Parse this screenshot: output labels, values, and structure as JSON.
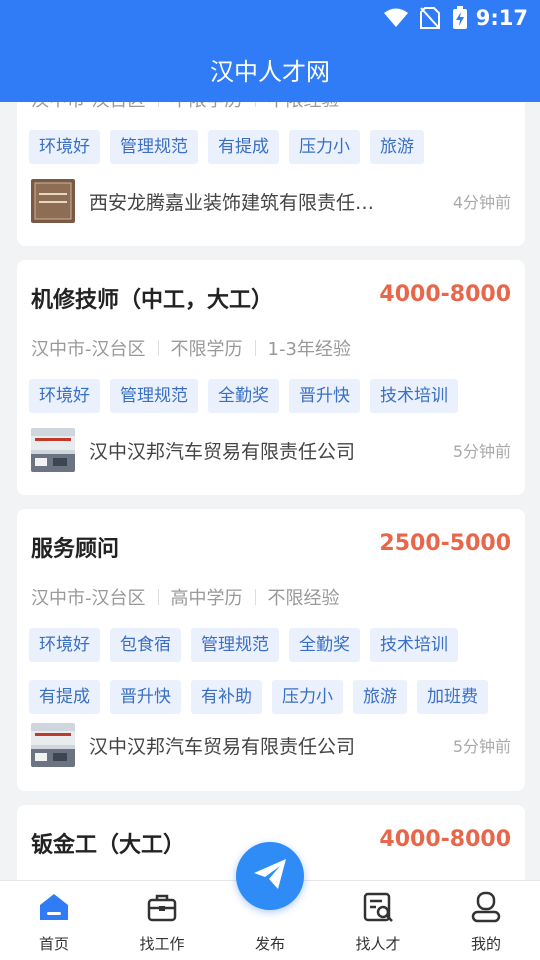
{
  "status": {
    "time": "9:17"
  },
  "app_title": "汉中人才网",
  "cards": [
    {
      "meta": [
        "汉中市-汉台区",
        "不限学历",
        "不限经验"
      ],
      "tags_rows": [
        [
          "环境好",
          "管理规范",
          "有提成",
          "压力小",
          "旅游"
        ]
      ],
      "company": "西安龙腾嘉业装饰建筑有限责任公司",
      "time_ago": "4分钟前"
    },
    {
      "title": "机修技师（中工，大工）",
      "salary": "4000-8000",
      "meta": [
        "汉中市-汉台区",
        "不限学历",
        "1-3年经验"
      ],
      "tags_rows": [
        [
          "环境好",
          "管理规范",
          "全勤奖",
          "晋升快",
          "技术培训"
        ]
      ],
      "company": "汉中汉邦汽车贸易有限责任公司",
      "time_ago": "5分钟前"
    },
    {
      "title": "服务顾问",
      "salary": "2500-5000",
      "meta": [
        "汉中市-汉台区",
        "高中学历",
        "不限经验"
      ],
      "tags_rows": [
        [
          "环境好",
          "包食宿",
          "管理规范",
          "全勤奖",
          "技术培训"
        ],
        [
          "有提成",
          "晋升快",
          "有补助",
          "压力小",
          "旅游",
          "加班费"
        ]
      ],
      "company": "汉中汉邦汽车贸易有限责任公司",
      "time_ago": "5分钟前"
    },
    {
      "title": "钣金工（大工）",
      "salary": "4000-8000"
    }
  ],
  "tabbar": [
    {
      "label": "首页",
      "icon": "home-icon"
    },
    {
      "label": "找工作",
      "icon": "briefcase-icon"
    },
    {
      "label": "发布",
      "icon": "send-icon"
    },
    {
      "label": "找人才",
      "icon": "resume-search-icon"
    },
    {
      "label": "我的",
      "icon": "user-icon"
    }
  ],
  "colors": {
    "primary": "#2f7cf6",
    "salary": "#e8664a",
    "tag_bg": "#eaf1fd",
    "tag_text": "#3a6fc4"
  }
}
